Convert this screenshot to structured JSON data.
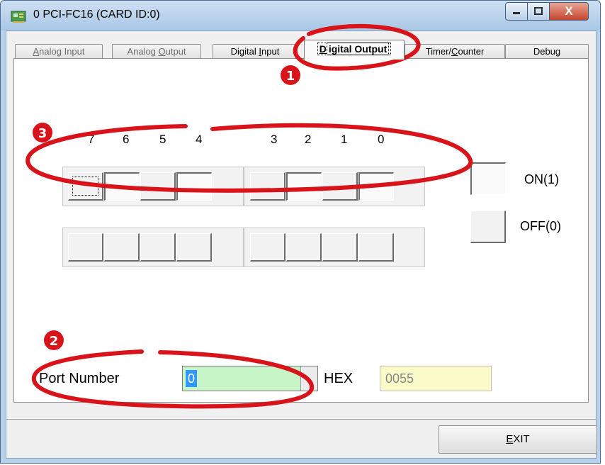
{
  "window": {
    "title": "0 PCI-FC16 (CARD ID:0)",
    "icon": "app-card-icon",
    "controls": {
      "minimize": "minimize-icon",
      "maximize": "maximize-icon",
      "close": "X"
    }
  },
  "tabs": [
    {
      "label_pre": "",
      "mnemonic": "A",
      "label_post": "nalog Input",
      "state": "disabled"
    },
    {
      "label_pre": "Analog ",
      "mnemonic": "O",
      "label_post": "utput",
      "state": "disabled"
    },
    {
      "label_pre": "Digital ",
      "mnemonic": "I",
      "label_post": "nput",
      "state": "normal"
    },
    {
      "label_pre": "",
      "mnemonic": "D",
      "label_post": "igital Output",
      "state": "active"
    },
    {
      "label_pre": "Timer/",
      "mnemonic": "C",
      "label_post": "ounter",
      "state": "normal"
    },
    {
      "label_pre": "Debug",
      "mnemonic": "",
      "label_post": "",
      "state": "normal"
    }
  ],
  "bit_labels": [
    "7",
    "6",
    "5",
    "4",
    "3",
    "2",
    "1",
    "0"
  ],
  "output_row": {
    "bits": [
      0,
      1,
      0,
      1,
      0,
      1,
      0,
      1
    ],
    "focused_bit_index": 0
  },
  "input_row": {
    "bits": [
      0,
      0,
      0,
      0,
      0,
      0,
      0,
      0
    ]
  },
  "legend": {
    "on_label": "ON(1)",
    "off_label": "OFF(0)"
  },
  "port": {
    "label": "Port Number",
    "value": "0"
  },
  "hex": {
    "label": "HEX",
    "value": "0055"
  },
  "exit_button": {
    "mnemonic": "E",
    "rest": "XIT"
  },
  "annotations": [
    "1",
    "2",
    "3"
  ],
  "colors": {
    "annotation_red": "#d8141a",
    "combo_bg": "#c8f5c8",
    "hex_bg": "#fbfbc9",
    "selection_blue": "#3399ff"
  }
}
